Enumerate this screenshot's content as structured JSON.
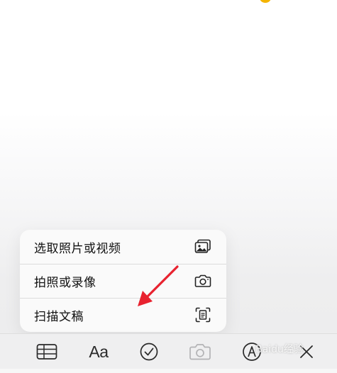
{
  "menu": {
    "items": [
      {
        "label": "选取照片或视频",
        "icon": "photo-library-icon"
      },
      {
        "label": "拍照或录像",
        "icon": "camera-icon"
      },
      {
        "label": "扫描文稿",
        "icon": "document-scan-icon"
      }
    ]
  },
  "toolbar": {
    "items": [
      {
        "name": "table-icon"
      },
      {
        "name": "text-format-icon",
        "label": "Aa"
      },
      {
        "name": "checklist-icon"
      },
      {
        "name": "camera-icon"
      },
      {
        "name": "markup-icon"
      },
      {
        "name": "close-icon"
      }
    ]
  },
  "watermark": {
    "text": "Baidu经验"
  },
  "colors": {
    "accent": "#f4b400",
    "arrow": "#e8222f",
    "toolbar_bg": "#efeff0",
    "menu_bg": "#fafafa"
  }
}
